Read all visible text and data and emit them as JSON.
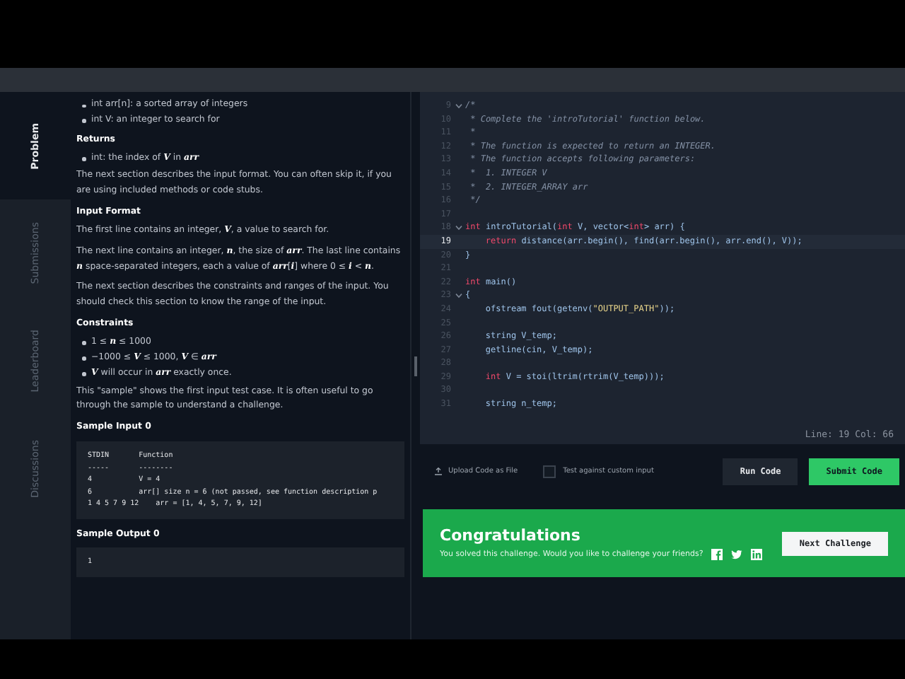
{
  "side_tabs": [
    {
      "label": "Problem",
      "selected": true
    },
    {
      "label": "Submissions",
      "selected": false
    },
    {
      "label": "Leaderboard",
      "selected": false
    },
    {
      "label": "Discussions",
      "selected": false
    }
  ],
  "problem": {
    "blocks": [
      {
        "kind": "bullet",
        "text": "int arr[n]: a sorted array of integers"
      },
      {
        "kind": "bullet",
        "text": "int V: an integer to search for"
      },
      {
        "kind": "heading",
        "text": "Returns"
      },
      {
        "kind": "bullet",
        "text": "int: the index of *V* in *arr*"
      },
      {
        "kind": "para",
        "text": "The next section describes the input format. You can often skip it, if you are using included methods or code stubs."
      },
      {
        "kind": "heading",
        "text": "Input Format"
      },
      {
        "kind": "para",
        "text": "The first line contains an integer, *V*, a value to search for."
      },
      {
        "kind": "para",
        "text": "The next line contains an integer, *n*, the size of *arr*. The last line contains *n* space-separated integers, each a value of *arr*[*i*] where 0 ≤ *i* < *n*."
      },
      {
        "kind": "para",
        "text": "The next section describes the constraints and ranges of the input. You should check this section to know the range of the input."
      },
      {
        "kind": "heading",
        "text": "Constraints"
      },
      {
        "kind": "bullet",
        "text": "1 ≤ *n* ≤ 1000"
      },
      {
        "kind": "bullet",
        "text": "−1000 ≤ *V* ≤ 1000, *V* ∈ *arr*"
      },
      {
        "kind": "bullet",
        "text": "*V* will occur in *arr* exactly once."
      },
      {
        "kind": "para",
        "text": "This \"sample\" shows the first input test case. It is often useful to go through the sample to understand a challenge."
      },
      {
        "kind": "heading",
        "text": "Sample Input 0"
      },
      {
        "kind": "code",
        "lines": [
          "STDIN       Function",
          "-----       --------",
          "4           V = 4",
          "6           arr[] size n = 6 (not passed, see function description p",
          "1 4 5 7 9 12    arr = [1, 4, 5, 7, 9, 12]"
        ]
      },
      {
        "kind": "heading",
        "text": "Sample Output 0"
      },
      {
        "kind": "code",
        "lines": [
          "1"
        ]
      }
    ]
  },
  "editor": {
    "lines": [
      {
        "number": "9",
        "foldable": true,
        "active": false,
        "tokens": [
          {
            "kind": "comment",
            "text": "/*"
          }
        ]
      },
      {
        "number": "10",
        "foldable": false,
        "active": false,
        "tokens": [
          {
            "kind": "comment",
            "text": " * Complete the 'introTutorial' function below."
          }
        ]
      },
      {
        "number": "11",
        "foldable": false,
        "active": false,
        "tokens": [
          {
            "kind": "comment",
            "text": " *"
          }
        ]
      },
      {
        "number": "12",
        "foldable": false,
        "active": false,
        "tokens": [
          {
            "kind": "comment",
            "text": " * The function is expected to return an INTEGER."
          }
        ]
      },
      {
        "number": "13",
        "foldable": false,
        "active": false,
        "tokens": [
          {
            "kind": "comment",
            "text": " * The function accepts following parameters:"
          }
        ]
      },
      {
        "number": "14",
        "foldable": false,
        "active": false,
        "tokens": [
          {
            "kind": "comment",
            "text": " *  1. INTEGER V"
          }
        ]
      },
      {
        "number": "15",
        "foldable": false,
        "active": false,
        "tokens": [
          {
            "kind": "comment",
            "text": " *  2. INTEGER_ARRAY arr"
          }
        ]
      },
      {
        "number": "16",
        "foldable": false,
        "active": false,
        "tokens": [
          {
            "kind": "comment",
            "text": " */"
          }
        ]
      },
      {
        "number": "17",
        "foldable": false,
        "active": false
      },
      {
        "number": "18",
        "foldable": true,
        "active": false,
        "tokens": [
          {
            "kind": "keyword",
            "text": "int"
          },
          {
            "kind": "plain",
            "text": " introTutorial("
          },
          {
            "kind": "keyword",
            "text": "int"
          },
          {
            "kind": "plain",
            "text": " V, vector<"
          },
          {
            "kind": "keyword",
            "text": "int"
          },
          {
            "kind": "plain",
            "text": "> arr) {"
          }
        ]
      },
      {
        "number": "19",
        "foldable": false,
        "active": true,
        "indent": true,
        "tokens": [
          {
            "kind": "keyword",
            "text": "return"
          },
          {
            "kind": "plain",
            "text": " distance(arr.begin(), find(arr.begin(), arr.end(), V));"
          }
        ]
      },
      {
        "number": "20",
        "foldable": false,
        "active": false,
        "tokens": [
          {
            "kind": "plain",
            "text": "}"
          }
        ]
      },
      {
        "number": "21",
        "foldable": false,
        "active": false
      },
      {
        "number": "22",
        "foldable": false,
        "active": false,
        "tokens": [
          {
            "kind": "keyword",
            "text": "int"
          },
          {
            "kind": "plain",
            "text": " main()"
          }
        ]
      },
      {
        "number": "23",
        "foldable": true,
        "active": false,
        "tokens": [
          {
            "kind": "plain",
            "text": "{"
          }
        ]
      },
      {
        "number": "24",
        "foldable": false,
        "active": false,
        "indent": true,
        "tokens": [
          {
            "kind": "plain",
            "text": "ofstream fout(getenv("
          },
          {
            "kind": "string",
            "text": "\"OUTPUT_PATH\""
          },
          {
            "kind": "plain",
            "text": "));"
          }
        ]
      },
      {
        "number": "25",
        "foldable": false,
        "active": false
      },
      {
        "number": "26",
        "foldable": false,
        "active": false,
        "indent": true,
        "tokens": [
          {
            "kind": "plain",
            "text": "string V_temp;"
          }
        ]
      },
      {
        "number": "27",
        "foldable": false,
        "active": false,
        "indent": true,
        "tokens": [
          {
            "kind": "plain",
            "text": "getline(cin, V_temp);"
          }
        ]
      },
      {
        "number": "28",
        "foldable": false,
        "active": false
      },
      {
        "number": "29",
        "foldable": false,
        "active": false,
        "indent": true,
        "tokens": [
          {
            "kind": "keyword",
            "text": "int"
          },
          {
            "kind": "plain",
            "text": " V = stoi(ltrim(rtrim(V_temp)));"
          }
        ]
      },
      {
        "number": "30",
        "foldable": false,
        "active": false
      },
      {
        "number": "31",
        "foldable": false,
        "active": false,
        "indent": true,
        "tokens": [
          {
            "kind": "plain",
            "text": "string n_temp;"
          }
        ]
      }
    ],
    "status": "Line: 19 Col: 66"
  },
  "actions": {
    "upload": "Upload Code as File",
    "custom_input": {
      "label": "Test against custom input",
      "checked": false
    },
    "run": "Run Code",
    "submit": "Submit Code"
  },
  "banner": {
    "title": "Congratulations",
    "message": "You solved this challenge. Would you like to challenge your friends?",
    "button": "Next Challenge"
  }
}
